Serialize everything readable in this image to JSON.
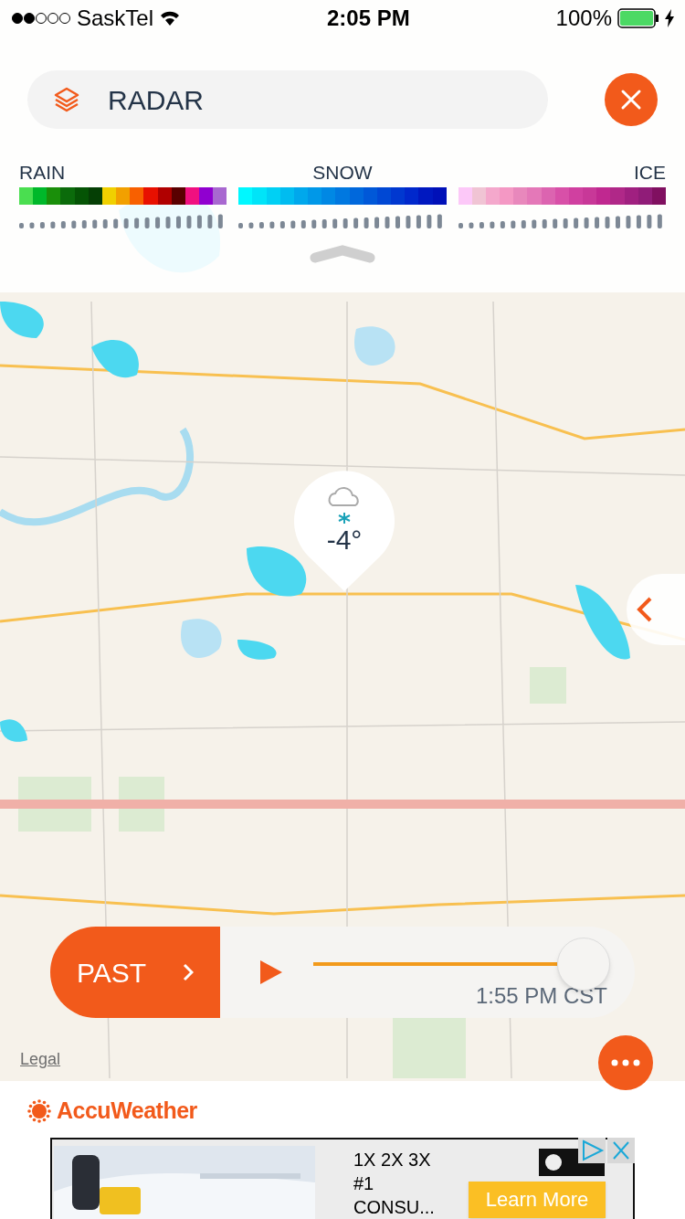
{
  "status_bar": {
    "carrier": "SaskTel",
    "time": "2:05 PM",
    "battery": "100%",
    "charging": true
  },
  "layer_bar": {
    "title": "RADAR"
  },
  "legend": [
    {
      "label": "RAIN",
      "swatches": [
        {
          "color": "#4ade50"
        },
        {
          "color": "#00b82a"
        },
        {
          "color": "#1a8f0a"
        },
        {
          "color": "#0b6b0b"
        },
        {
          "color": "#055405"
        },
        {
          "color": "#053f05"
        },
        {
          "color": "#f0d000"
        },
        {
          "color": "#f2a000"
        },
        {
          "color": "#f86000"
        },
        {
          "color": "#e81000"
        },
        {
          "color": "#b00000"
        },
        {
          "color": "#5a0000"
        },
        {
          "color": "#f01080"
        },
        {
          "color": "#9000d0"
        },
        {
          "color": "#a868d0"
        }
      ]
    },
    {
      "label": "SNOW",
      "swatches": [
        {
          "color": "#00f8ff"
        },
        {
          "color": "#00e4f8"
        },
        {
          "color": "#00d0f4"
        },
        {
          "color": "#00bcf0"
        },
        {
          "color": "#00a8ec"
        },
        {
          "color": "#0098e8"
        },
        {
          "color": "#0088e4"
        },
        {
          "color": "#0078e0"
        },
        {
          "color": "#0068dc"
        },
        {
          "color": "#0058d8"
        },
        {
          "color": "#0048d4"
        },
        {
          "color": "#0038d0"
        },
        {
          "color": "#0028cc"
        },
        {
          "color": "#0018c0"
        },
        {
          "color": "#0010b8"
        }
      ]
    },
    {
      "label": "ICE",
      "swatches": [
        {
          "color": "#fcc8f8"
        },
        {
          "color": "#f0c4d4"
        },
        {
          "color": "#f4a8cc"
        },
        {
          "color": "#f498c4"
        },
        {
          "color": "#e888bc"
        },
        {
          "color": "#e478b8"
        },
        {
          "color": "#dc64b0"
        },
        {
          "color": "#d850a8"
        },
        {
          "color": "#d040a0"
        },
        {
          "color": "#c83898"
        },
        {
          "color": "#c02890"
        },
        {
          "color": "#b02888"
        },
        {
          "color": "#a02080"
        },
        {
          "color": "#901c78"
        },
        {
          "color": "#801060"
        }
      ]
    }
  ],
  "weather_pin": {
    "temperature": "-4°"
  },
  "timeline": {
    "mode": "PAST",
    "time": "1:55 PM CST",
    "level": 0.92,
    "playing": false
  },
  "map": {
    "legal": "Legal"
  },
  "brand": "AccuWeather",
  "ad": {
    "lines": [
      "1X 2X 3X",
      "#1",
      "CONSU..."
    ],
    "button": "Learn More"
  }
}
